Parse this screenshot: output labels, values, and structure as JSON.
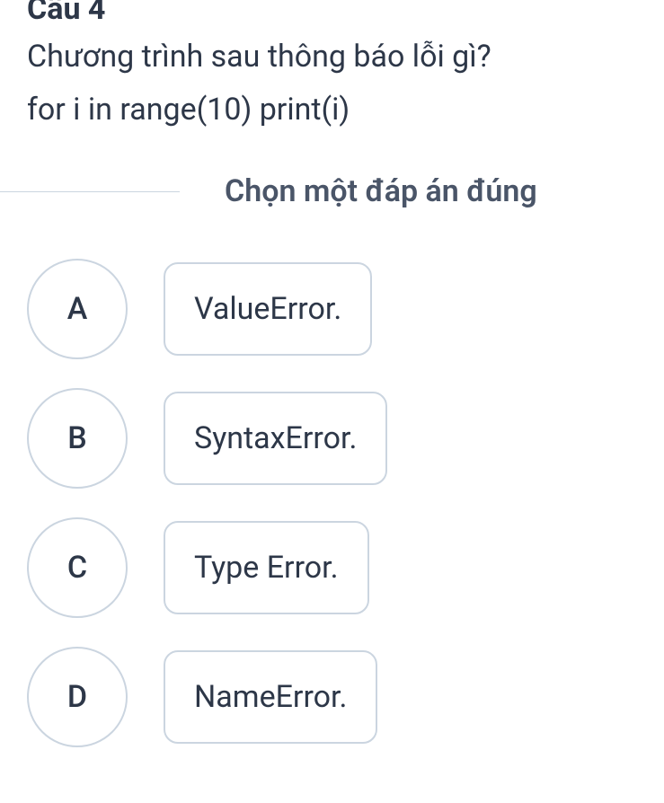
{
  "question": {
    "number": "Câu 4",
    "text": "Chương trình sau thông báo lỗi gì?",
    "code": "for i in range(10) print(i)"
  },
  "instruction": "Chọn một đáp án đúng",
  "options": [
    {
      "letter": "A",
      "text": "ValueError."
    },
    {
      "letter": "B",
      "text": "SyntaxError."
    },
    {
      "letter": "C",
      "text": "Type Error."
    },
    {
      "letter": "D",
      "text": "NameError."
    }
  ]
}
